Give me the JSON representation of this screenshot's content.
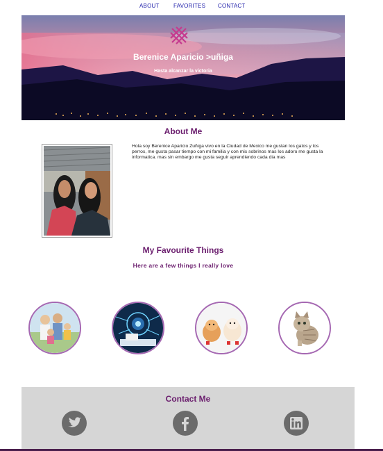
{
  "nav": {
    "items": [
      {
        "label": "ABOUT"
      },
      {
        "label": "FAVORITES"
      },
      {
        "label": "CONTACT"
      }
    ]
  },
  "hero": {
    "title": "Berenice Aparicio >uñiga",
    "subtitle": "Hasta alcanzar la victoria",
    "logo_icon": "cross-hatch-logo-icon"
  },
  "about": {
    "heading": "About Me",
    "text": "Hola soy Berenice Aparicio Zuñiga vivo en la Ciudad de Mexico me gustan los gatos y los perros, me gusta pasar tiempo con mi familia y con mis sobrinos mas los adoro me gusta la informatica. mas sin embargo me gusta seguir aprendiendo cada dia mas"
  },
  "favourites": {
    "heading": "My Favourite Things",
    "subheading": "Here are a few things I really love",
    "items": [
      {
        "icon": "family-photo"
      },
      {
        "icon": "technology-photo"
      },
      {
        "icon": "dogs-photo"
      },
      {
        "icon": "cat-photo"
      }
    ]
  },
  "contact": {
    "heading": "Contact Me",
    "social": [
      {
        "icon": "twitter-icon"
      },
      {
        "icon": "facebook-icon"
      },
      {
        "icon": "linkedin-icon"
      }
    ]
  },
  "colors": {
    "accent": "#6b1e6e",
    "circle_border": "#a568b2",
    "nav_link": "#1a1aa8",
    "contact_bg": "#d6d6d6",
    "social_icon": "#6b6b6b"
  }
}
